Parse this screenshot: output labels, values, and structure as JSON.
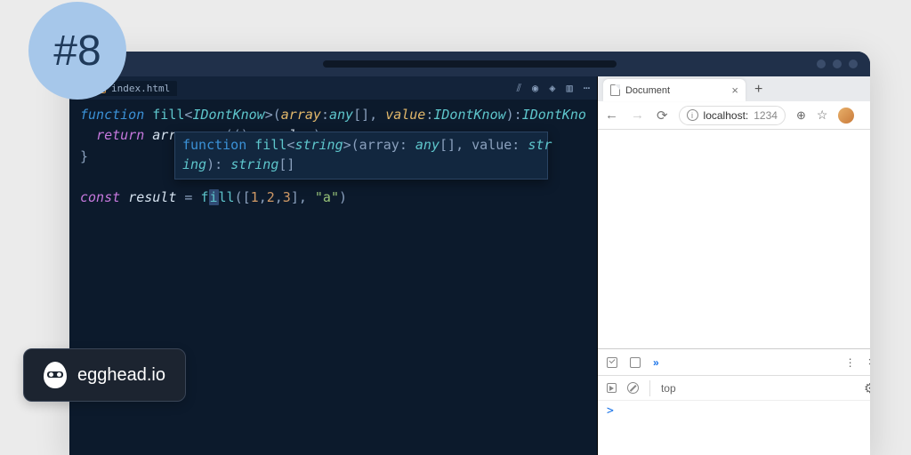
{
  "badge": {
    "label": "#8"
  },
  "brand": {
    "name": "egghead.io"
  },
  "editor": {
    "tab": {
      "filename": "index.html"
    },
    "code": {
      "l1": {
        "kw": "function",
        "name": "fill",
        "gen_open": "<",
        "gen": "IDontKnow",
        "gen_close": ">",
        "p_open": "(",
        "p1": "array",
        "colon1": ":",
        "t1": "any",
        "arr1": "[]",
        "comma": ", ",
        "p2": "value",
        "colon2": ":",
        "t2": "IDontKnow",
        "p_close": "):",
        "ret": "IDontKno"
      },
      "l2": {
        "kw": "return",
        "sp": " ",
        "obj": "array",
        "dot": ".",
        "meth": "map",
        "args": "(()=> ",
        "val": "value",
        "close": ")"
      },
      "l3": {
        "brace": "}"
      },
      "l4": {
        "kw": "const",
        "sp": " ",
        "var": "result",
        "eq": " = ",
        "call_pre": "f",
        "call_hl": "i",
        "call_post": "ll",
        "open": "([",
        "n1": "1",
        "c1": ",",
        "n2": "2",
        "c2": ",",
        "n3": "3",
        "close_arr": "], ",
        "str": "\"a\"",
        "close": ")"
      }
    },
    "tooltip": {
      "kw": "function",
      "name": "fill",
      "gen_open": "<",
      "gen": "string",
      "gen_close": ">",
      "sig1": "(array: ",
      "t1": "any",
      "arr": "[]",
      "sig2": ", value: ",
      "t2": "str",
      "line2_a": "ing",
      "line2_b": "): ",
      "ret": "string",
      "retarr": "[]"
    }
  },
  "browser": {
    "tab": {
      "title": "Document"
    },
    "url": {
      "host": "localhost:",
      "port": "1234"
    },
    "devtools": {
      "context": "top",
      "prompt": ">"
    }
  }
}
